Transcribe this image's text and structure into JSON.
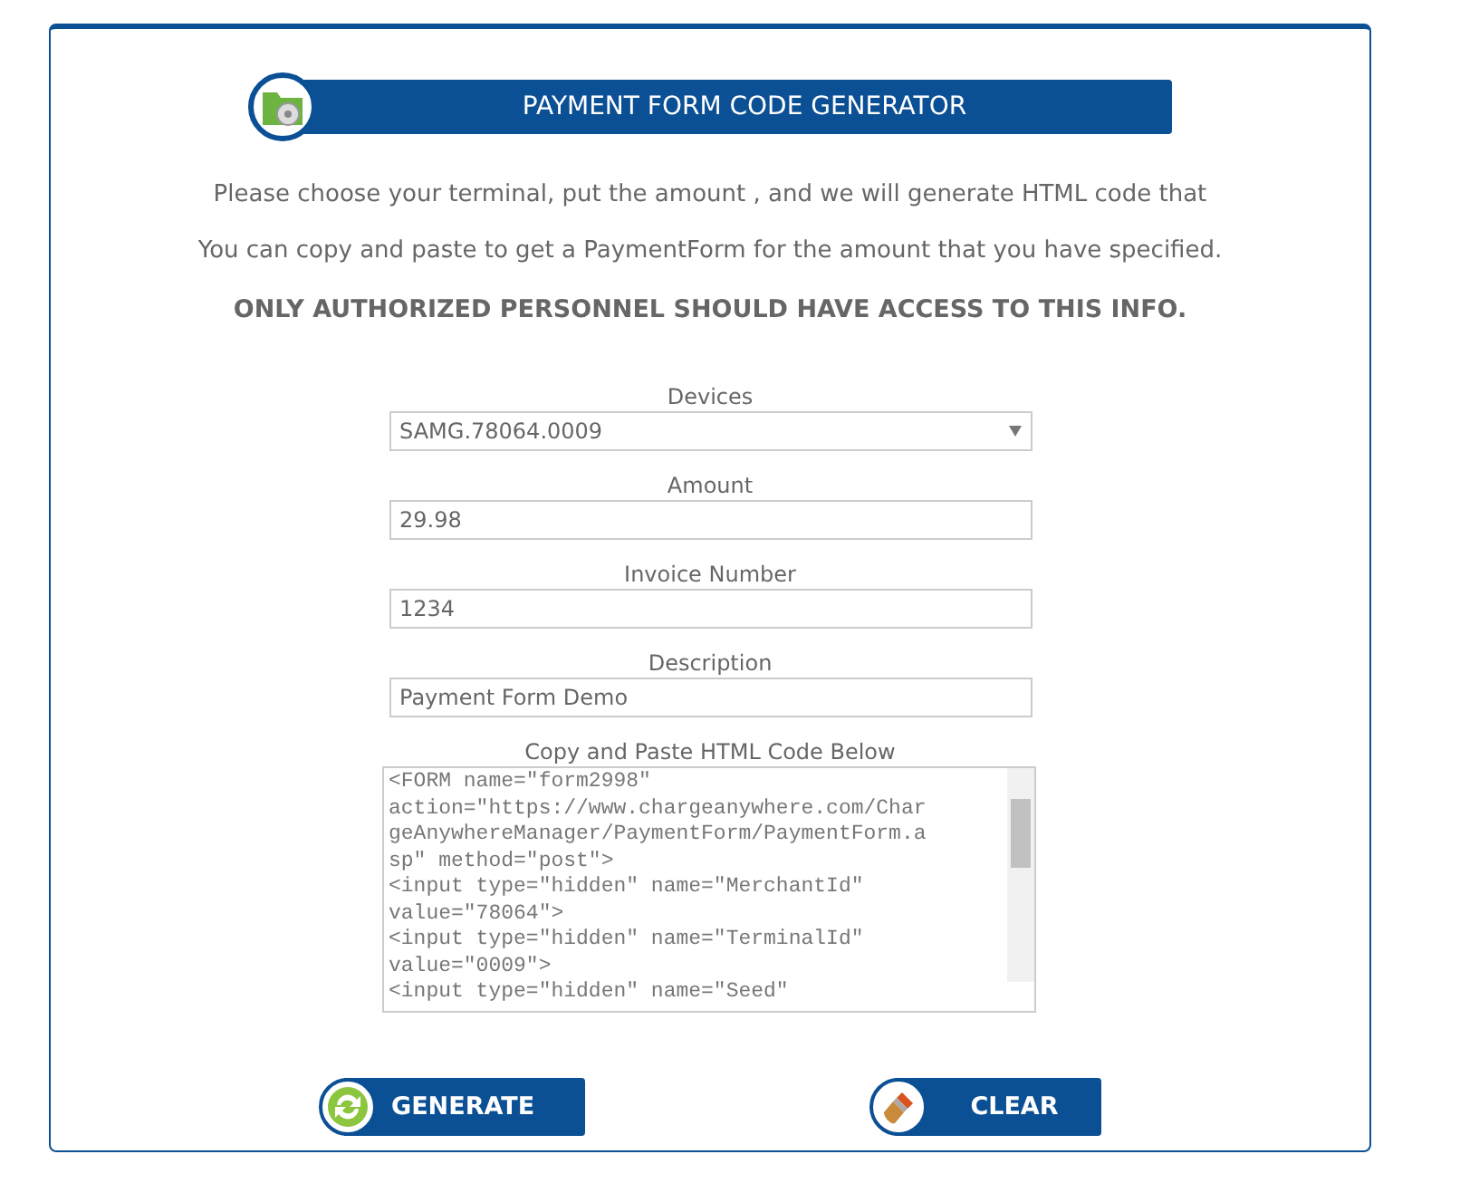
{
  "header": {
    "title": "PAYMENT FORM CODE GENERATOR"
  },
  "intro": [
    "Please choose your terminal, put the amount , and we will generate HTML code that",
    "You can copy and paste to get a PaymentForm for the amount that you have specified."
  ],
  "warning": "ONLY AUTHORIZED PERSONNEL SHOULD HAVE ACCESS TO THIS INFO.",
  "fields": [
    {
      "kind": "select",
      "label": "Devices",
      "value": "SAMG.78064.0009"
    },
    {
      "kind": "text",
      "label": "Amount",
      "value": "29.98"
    },
    {
      "kind": "text",
      "label": "Invoice Number",
      "value": "1234"
    },
    {
      "kind": "text",
      "label": "Description",
      "value": "Payment Form Demo"
    }
  ],
  "code": {
    "label": "Copy and Paste HTML Code Below",
    "lines": [
      "<FORM name=\"form2998\"",
      "action=\"https://www.chargeanywhere.com/Char",
      "geAnywhereManager/PaymentForm/PaymentForm.a",
      "sp\" method=\"post\">",
      "<input type=\"hidden\" name=\"MerchantId\"",
      "value=\"78064\">",
      "<input type=\"hidden\" name=\"TerminalId\"",
      "value=\"0009\">",
      "<input type=\"hidden\" name=\"Seed\""
    ]
  },
  "buttons": [
    {
      "kind": "generate",
      "label": "GENERATE"
    },
    {
      "kind": "clear",
      "label": "CLEAR"
    }
  ]
}
